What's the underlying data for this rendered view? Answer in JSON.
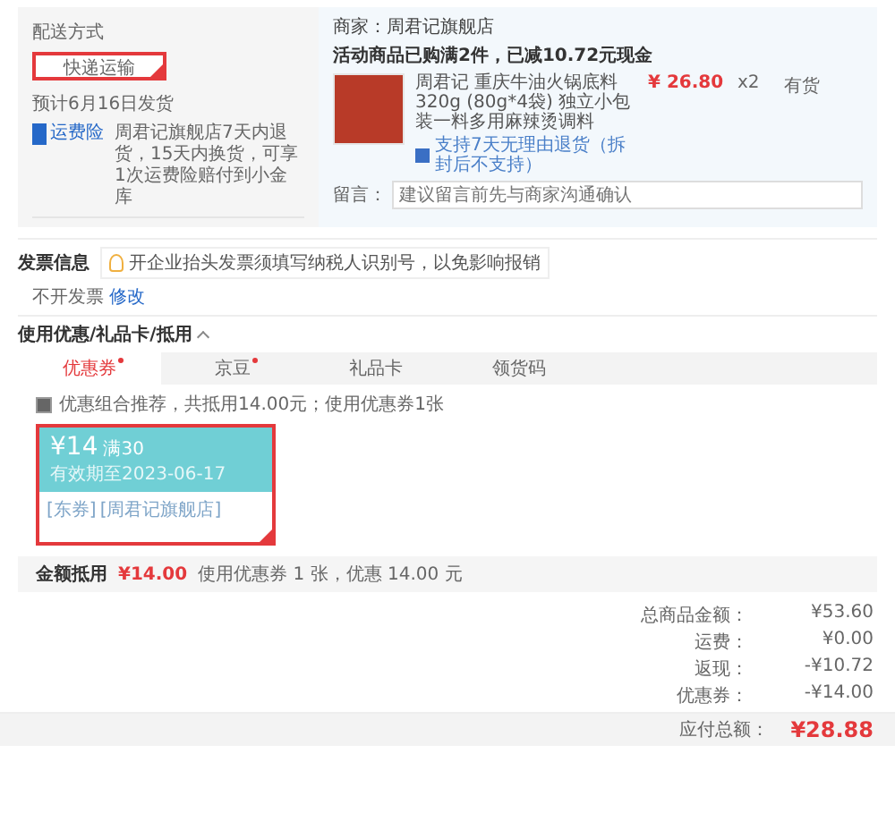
{
  "delivery": {
    "heading": "配送方式",
    "options": [
      {
        "label": "快递运输",
        "selected": true
      }
    ],
    "ship_date": "预计6月16日发货",
    "insurance_badge": "运费险",
    "insurance_text": "周君记旗舰店7天内退货，15天内换货，可享1次运费险赔付到小金库"
  },
  "shop": {
    "seller": "商家：周君记旗舰店",
    "promo": "活动商品已购满2件，已减10.72元现金",
    "items": [
      {
        "title": "周君记 重庆牛油火锅底料320g (80g*4袋) 独立小包装一料多用麻辣烫调料",
        "return_note": "支持7天无理由退货（拆封后不支持）",
        "price": "¥ 26.80",
        "qty": "x2",
        "stock": "有货"
      }
    ],
    "message_label": "留言：",
    "message_placeholder": "建议留言前先与商家沟通确认"
  },
  "invoice": {
    "heading": "发票信息",
    "tip": "开企业抬头发票须填写纳税人识别号，以免影响报销",
    "value": "不开发票",
    "edit_link": "修改"
  },
  "discounts": {
    "heading": "使用优惠/礼品卡/抵用",
    "expanded": true,
    "tabs": [
      {
        "label": "优惠券",
        "selected": true,
        "dot": true
      },
      {
        "label": "京豆",
        "selected": false,
        "dot": true
      },
      {
        "label": "礼品卡",
        "selected": false,
        "dot": false
      },
      {
        "label": "领货码",
        "selected": false,
        "dot": false
      }
    ],
    "recommend": {
      "checked": true,
      "text": "优惠组合推荐，共抵用14.00元；使用优惠券1张"
    },
    "coupons": [
      {
        "amount": "¥14",
        "condition": "满30",
        "expiry": "有效期至2023-06-17",
        "tags": [
          "[东券]",
          "[周君记旗舰店]"
        ],
        "selected": true
      }
    ],
    "total_label": "金额抵用",
    "total_value": "¥14.00",
    "total_note": "使用优惠券 1 张，优惠 14.00 元"
  },
  "summary": {
    "rows": [
      {
        "label": "总商品金额：",
        "value": "¥53.60"
      },
      {
        "label": "运费：",
        "value": "¥0.00"
      },
      {
        "label": "返现：",
        "value": "-¥10.72"
      },
      {
        "label": "优惠券：",
        "value": "-¥14.00"
      }
    ],
    "payable_label": "应付总额：",
    "payable_value": "¥28.88"
  }
}
